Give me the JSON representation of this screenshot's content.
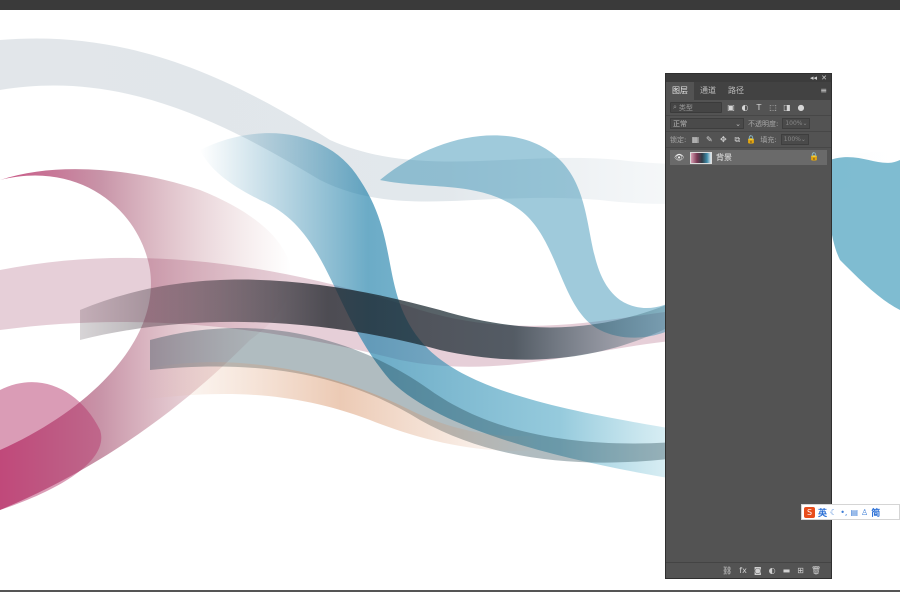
{
  "layers_panel": {
    "tabs": [
      "图层",
      "通道",
      "路径"
    ],
    "active_tab": 0,
    "filter_placeholder": "类型",
    "blend_mode": "正常",
    "opacity_label": "不透明度:",
    "opacity_value": "100%",
    "lock_label": "锁定:",
    "fill_label": "填充:",
    "fill_value": "100%",
    "layers": [
      {
        "name": "背景",
        "visible": true,
        "locked": true
      }
    ],
    "bottom_icons": [
      "link-icon",
      "fx-icon",
      "mask-icon",
      "adjustment-icon",
      "group-icon",
      "new-layer-icon",
      "trash-icon"
    ]
  },
  "ime": {
    "lang": "英",
    "mode": "简"
  },
  "colors": {
    "panel_bg": "#535353",
    "tab_bar": "#424242",
    "selected_layer": "#6a6a6a",
    "ime_accent": "#e84d1c"
  }
}
